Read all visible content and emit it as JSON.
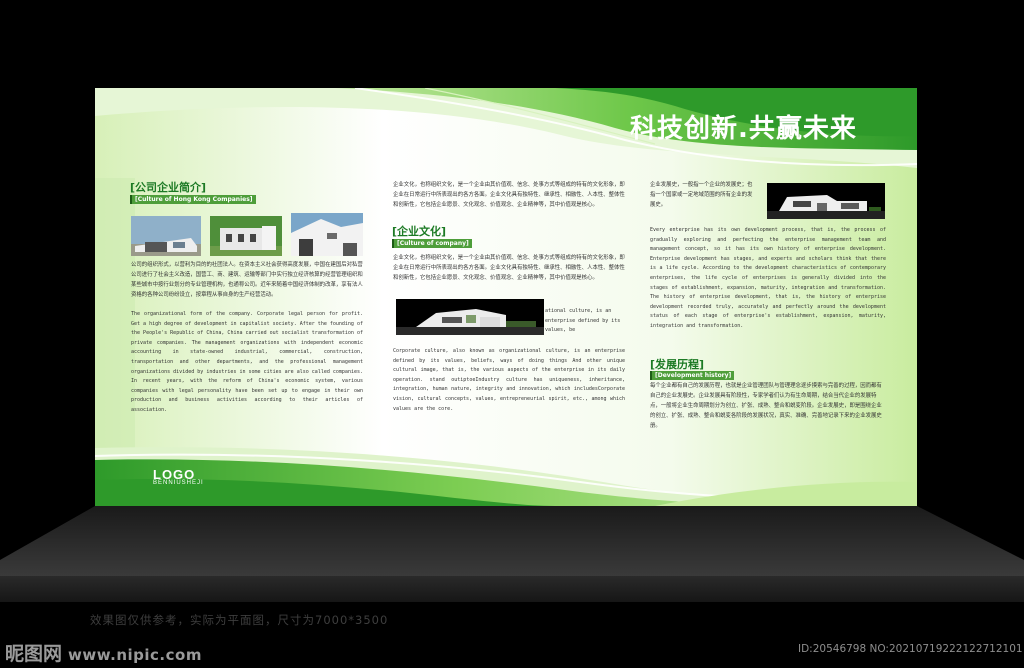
{
  "headline": "科技创新.共赢未来",
  "sections": {
    "profile": {
      "title": "[公司企业简介]",
      "subtitle": "[Culture of Hong Kong Companies]",
      "body_zh": "公司的组织形式，以营利为目的的社团法人。在资本主义社会获得高度发展，中国在建国后对私营公司进行了社会主义改造，国营工、商、建筑、运输等部门中实行独立经济核算的经营管理组织和某些城市中按行业划分的专业管理机构，也通称公司。近年来随着中国经济体制的改革，享有法人资格的各种公司纷纷设立，按章程从事自身的生产经营活动。",
      "body_en": "The organizational form of the company. Corporate legal person for profit. Get a high degree of development in capitalist society. After the founding of the People's Republic of China, China carried out socialist transformation of private companies. The management organizations with independent economic accounting in state-owned industrial, commercial, construction, transportation and other departments, and the professional management organizations divided by industries in some cities are also called companies. In recent years, with the reform of China's economic system, various companies with legal personality have been set up to engage in their own production and business activities according to their articles of association."
    },
    "culture": {
      "intro_zh": "企业文化，也称组织文化，是一个企业由其价值观、信念、处事方式等组成的特有的文化形象，即企业在日常运行中所表现出的各方各面。企业文化具有独特性、继承性、相融性、人本性、整体性和创新性，它包括企业愿景、文化观念、价值观念、企业精神等，其中价值观是核心。",
      "title": "[企业文化]",
      "subtitle": "[Culture of company]",
      "body_zh": "企业文化，也称组织文化，是一个企业由其价值观、信念、处事方式等组成的特有的文化形象，即企业在日常运行中所表现出的各方各面。企业文化具有独特性、继承性、相融性、人本性、整体性和创新性，它包括企业愿景、文化观念、价值观念、企业精神等，其中价值观是核心。",
      "side_en": "ational culture, is an enterprise defined by its values, be",
      "body_en": "Corporate culture, also known as organizational culture, is an enterprise defined by its values, beliefs, ways of doing things And other unique cultural image, that is, the various aspects of the enterprise in its daily operation. stand outiptoeIndustry culture has uniqueness, inheritance, integration, human nature, integrity and innovation, which includesCorporate vision, cultural concepts, values, entrepreneurial spirit, etc., among which values are the core."
    },
    "development": {
      "intro_zh": "企业发展史，一般指一个企业的发展史；也指一个国家或一定地域范围的所有企业的发展史。",
      "body_en": "Every enterprise has its own development process, that is, the process of gradually exploring and perfecting the enterprise management team and management concept, so it has its own history of enterprise development. Enterprise development has stages, and experts and scholars think that there is a life cycle. According to the development characteristics of contemporary enterprises, the life cycle of enterprises is generally divided into the stages of establishment, expansion, maturity, integration and transformation. The history of enterprise development, that is, the history of enterprise development recorded truly, accurately and perfectly around the development status of each stage of enterprise's establishment, expansion, maturity, integration and transformation.",
      "title": "[发展历程]",
      "subtitle": "[Development history]",
      "body_zh": "每个企业都有自己的发展历程，也就是企业管理团队与管理理念逐步摸索与完善的过程，因而都有自己的企业发展史。企业发展具有阶段性，专家学者们认为有生命周期，结合当代企业的发展特点，一般将企业生命周期划分为创立、扩张、成熟、整合和蜕变阶段。企业发展史，即是围绕企业的创立、扩张、成熟、整合和蜕变各阶段的发展状况，真实、准确、完善地记录下来的企业发展史册。"
    }
  },
  "logo": {
    "title": "LOGO",
    "subtitle": "BENNIUSHEJI"
  },
  "footer_note": "效果图仅供参考，实际为平面图，尺寸为7000*3500",
  "watermark": {
    "site": "昵图网",
    "url": "www.nipic.com",
    "id_text": "ID:20546798 NO:20210719222122712101"
  },
  "colors": {
    "green_dark": "#2e9a2a",
    "green_light": "#a6dd7a",
    "title_green": "#1c7a24"
  }
}
